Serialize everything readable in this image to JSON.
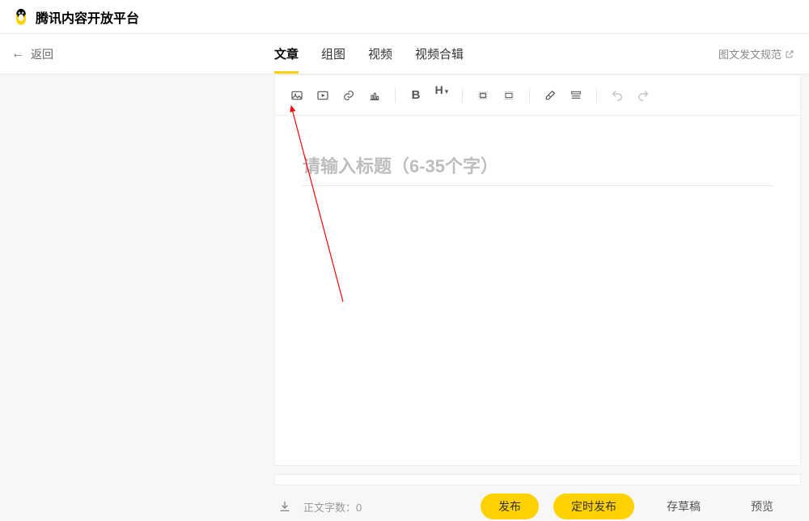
{
  "header": {
    "brand": "腾讯内容开放平台"
  },
  "nav": {
    "back": "返回",
    "tabs": [
      "文章",
      "组图",
      "视频",
      "视频合辑"
    ],
    "active_tab_index": 0,
    "guide": "图文发文规范"
  },
  "toolbar": {
    "buttons": [
      {
        "name": "image-icon"
      },
      {
        "name": "video-embed-icon"
      },
      {
        "name": "link-icon"
      },
      {
        "name": "chart-icon"
      },
      {
        "sep": true
      },
      {
        "name": "bold-icon",
        "glyph": "B",
        "bold": true
      },
      {
        "name": "heading-icon",
        "glyph": "H",
        "sub": "▾"
      },
      {
        "sep": true
      },
      {
        "name": "align-left-icon"
      },
      {
        "name": "align-center-icon"
      },
      {
        "sep": true
      },
      {
        "name": "eraser-icon"
      },
      {
        "name": "block-icon"
      },
      {
        "sep": true
      },
      {
        "name": "undo-icon"
      },
      {
        "name": "redo-icon"
      }
    ]
  },
  "editor": {
    "title_placeholder": "请输入标题（6-35个字）",
    "title_value": ""
  },
  "footer": {
    "word_count_label": "正文字数：",
    "word_count_value": "0",
    "publish": "发布",
    "schedule": "定时发布",
    "draft": "存草稿",
    "preview": "预览"
  }
}
